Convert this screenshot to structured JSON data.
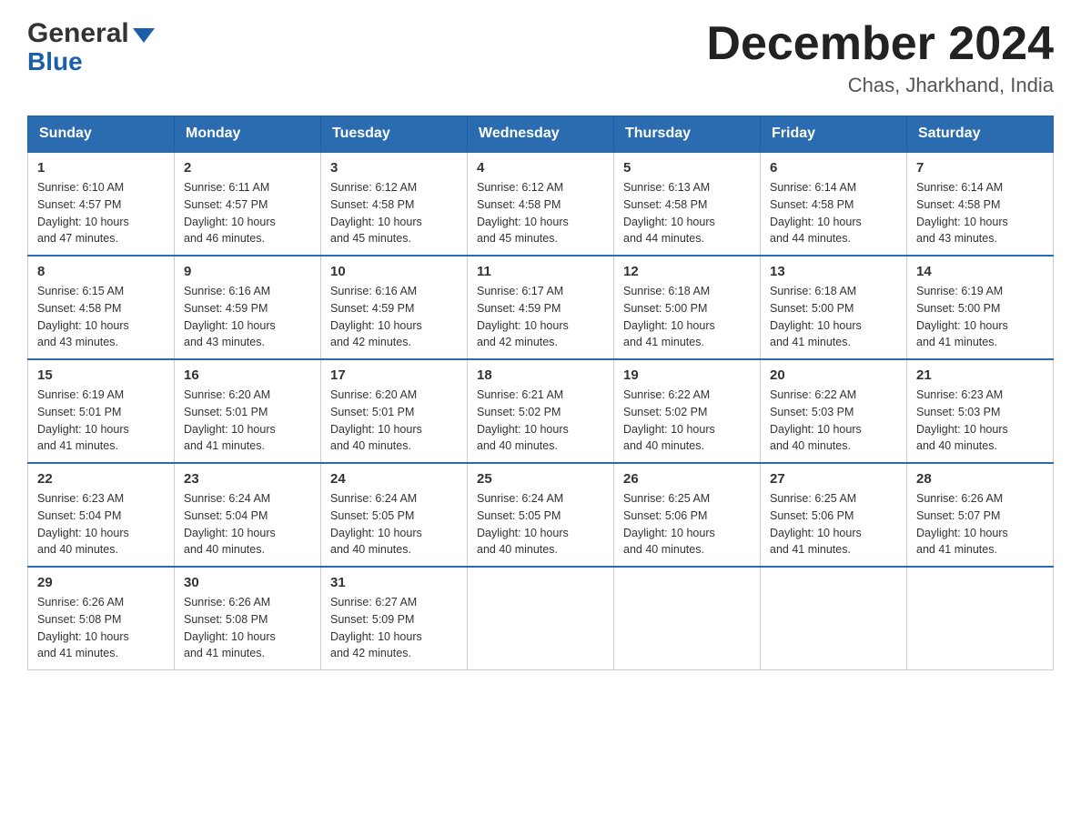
{
  "header": {
    "logo_general": "General",
    "logo_blue": "Blue",
    "month_title": "December 2024",
    "location": "Chas, Jharkhand, India"
  },
  "days_of_week": [
    "Sunday",
    "Monday",
    "Tuesday",
    "Wednesday",
    "Thursday",
    "Friday",
    "Saturday"
  ],
  "weeks": [
    [
      {
        "day": "1",
        "sunrise": "6:10 AM",
        "sunset": "4:57 PM",
        "daylight": "10 hours and 47 minutes."
      },
      {
        "day": "2",
        "sunrise": "6:11 AM",
        "sunset": "4:57 PM",
        "daylight": "10 hours and 46 minutes."
      },
      {
        "day": "3",
        "sunrise": "6:12 AM",
        "sunset": "4:58 PM",
        "daylight": "10 hours and 45 minutes."
      },
      {
        "day": "4",
        "sunrise": "6:12 AM",
        "sunset": "4:58 PM",
        "daylight": "10 hours and 45 minutes."
      },
      {
        "day": "5",
        "sunrise": "6:13 AM",
        "sunset": "4:58 PM",
        "daylight": "10 hours and 44 minutes."
      },
      {
        "day": "6",
        "sunrise": "6:14 AM",
        "sunset": "4:58 PM",
        "daylight": "10 hours and 44 minutes."
      },
      {
        "day": "7",
        "sunrise": "6:14 AM",
        "sunset": "4:58 PM",
        "daylight": "10 hours and 43 minutes."
      }
    ],
    [
      {
        "day": "8",
        "sunrise": "6:15 AM",
        "sunset": "4:58 PM",
        "daylight": "10 hours and 43 minutes."
      },
      {
        "day": "9",
        "sunrise": "6:16 AM",
        "sunset": "4:59 PM",
        "daylight": "10 hours and 43 minutes."
      },
      {
        "day": "10",
        "sunrise": "6:16 AM",
        "sunset": "4:59 PM",
        "daylight": "10 hours and 42 minutes."
      },
      {
        "day": "11",
        "sunrise": "6:17 AM",
        "sunset": "4:59 PM",
        "daylight": "10 hours and 42 minutes."
      },
      {
        "day": "12",
        "sunrise": "6:18 AM",
        "sunset": "5:00 PM",
        "daylight": "10 hours and 41 minutes."
      },
      {
        "day": "13",
        "sunrise": "6:18 AM",
        "sunset": "5:00 PM",
        "daylight": "10 hours and 41 minutes."
      },
      {
        "day": "14",
        "sunrise": "6:19 AM",
        "sunset": "5:00 PM",
        "daylight": "10 hours and 41 minutes."
      }
    ],
    [
      {
        "day": "15",
        "sunrise": "6:19 AM",
        "sunset": "5:01 PM",
        "daylight": "10 hours and 41 minutes."
      },
      {
        "day": "16",
        "sunrise": "6:20 AM",
        "sunset": "5:01 PM",
        "daylight": "10 hours and 41 minutes."
      },
      {
        "day": "17",
        "sunrise": "6:20 AM",
        "sunset": "5:01 PM",
        "daylight": "10 hours and 40 minutes."
      },
      {
        "day": "18",
        "sunrise": "6:21 AM",
        "sunset": "5:02 PM",
        "daylight": "10 hours and 40 minutes."
      },
      {
        "day": "19",
        "sunrise": "6:22 AM",
        "sunset": "5:02 PM",
        "daylight": "10 hours and 40 minutes."
      },
      {
        "day": "20",
        "sunrise": "6:22 AM",
        "sunset": "5:03 PM",
        "daylight": "10 hours and 40 minutes."
      },
      {
        "day": "21",
        "sunrise": "6:23 AM",
        "sunset": "5:03 PM",
        "daylight": "10 hours and 40 minutes."
      }
    ],
    [
      {
        "day": "22",
        "sunrise": "6:23 AM",
        "sunset": "5:04 PM",
        "daylight": "10 hours and 40 minutes."
      },
      {
        "day": "23",
        "sunrise": "6:24 AM",
        "sunset": "5:04 PM",
        "daylight": "10 hours and 40 minutes."
      },
      {
        "day": "24",
        "sunrise": "6:24 AM",
        "sunset": "5:05 PM",
        "daylight": "10 hours and 40 minutes."
      },
      {
        "day": "25",
        "sunrise": "6:24 AM",
        "sunset": "5:05 PM",
        "daylight": "10 hours and 40 minutes."
      },
      {
        "day": "26",
        "sunrise": "6:25 AM",
        "sunset": "5:06 PM",
        "daylight": "10 hours and 40 minutes."
      },
      {
        "day": "27",
        "sunrise": "6:25 AM",
        "sunset": "5:06 PM",
        "daylight": "10 hours and 41 minutes."
      },
      {
        "day": "28",
        "sunrise": "6:26 AM",
        "sunset": "5:07 PM",
        "daylight": "10 hours and 41 minutes."
      }
    ],
    [
      {
        "day": "29",
        "sunrise": "6:26 AM",
        "sunset": "5:08 PM",
        "daylight": "10 hours and 41 minutes."
      },
      {
        "day": "30",
        "sunrise": "6:26 AM",
        "sunset": "5:08 PM",
        "daylight": "10 hours and 41 minutes."
      },
      {
        "day": "31",
        "sunrise": "6:27 AM",
        "sunset": "5:09 PM",
        "daylight": "10 hours and 42 minutes."
      },
      null,
      null,
      null,
      null
    ]
  ],
  "labels": {
    "sunrise": "Sunrise:",
    "sunset": "Sunset:",
    "daylight": "Daylight:"
  }
}
